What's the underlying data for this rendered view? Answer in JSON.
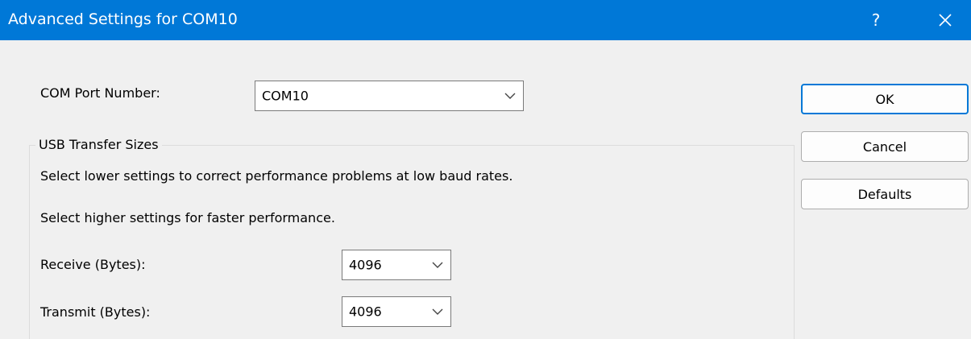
{
  "window": {
    "title": "Advanced Settings for COM10",
    "help_label": "?",
    "close_icon": "close-icon",
    "accent_color": "#0078d7"
  },
  "com_port": {
    "label": "COM Port Number:",
    "value": "COM10"
  },
  "usb_group": {
    "caption": "USB Transfer Sizes",
    "hint_lower": "Select lower settings to correct performance problems at low baud rates.",
    "hint_higher": "Select higher settings for faster performance.",
    "receive_label": "Receive (Bytes):",
    "receive_value": "4096",
    "transmit_label": "Transmit (Bytes):",
    "transmit_value": "4096"
  },
  "buttons": {
    "ok": "OK",
    "cancel": "Cancel",
    "defaults": "Defaults"
  }
}
